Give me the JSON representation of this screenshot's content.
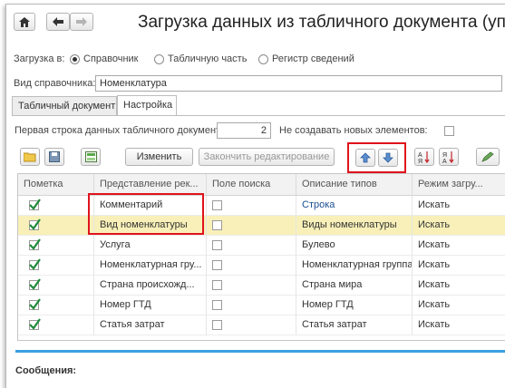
{
  "window": {
    "title": "Загрузка данных из табличного документа (управляе",
    "home_icon": "home-icon",
    "back_icon": "arrow-left-icon",
    "forward_icon": "arrow-right-icon"
  },
  "load_to": {
    "label": "Загрузка в:",
    "options": [
      {
        "label": "Справочник",
        "selected": true
      },
      {
        "label": "Табличную часть",
        "selected": false
      },
      {
        "label": "Регистр сведений",
        "selected": false
      }
    ]
  },
  "catalog_type": {
    "label": "Вид справочника:",
    "value": "Номенклатура"
  },
  "tabs": [
    {
      "label": "Табличный документ",
      "active": false
    },
    {
      "label": "Настройка",
      "active": true
    }
  ],
  "first_row": {
    "label": "Первая строка данных табличного документа:",
    "value": "2"
  },
  "no_new_elements": {
    "label": "Не создавать новых элементов:",
    "checked": false
  },
  "toolbar": {
    "edit_label": "Изменить",
    "finish_edit_label": "Закончить редактирование",
    "icons": [
      "open-folder-icon",
      "save-icon",
      "table-edit-icon",
      "move-up-icon",
      "move-down-icon",
      "sort-asc-icon",
      "sort-desc-icon"
    ]
  },
  "table": {
    "columns": [
      "Пометка",
      "Представление рек...",
      "Поле поиска",
      "Описание типов",
      "Режим загру..."
    ],
    "rows": [
      {
        "mark": true,
        "name": "Комментарий",
        "search": false,
        "types": "Строка",
        "mode": "Искать",
        "types_link": true
      },
      {
        "mark": true,
        "name": "Вид номенклатуры",
        "search": false,
        "types": "Виды номенклатуры",
        "mode": "Искать",
        "selected": true
      },
      {
        "mark": true,
        "name": "Услуга",
        "search": false,
        "types": "Булево",
        "mode": "Искать"
      },
      {
        "mark": true,
        "name": "Номенклатурная гру...",
        "search": false,
        "types": "Номенклатурная группа",
        "mode": "Искать"
      },
      {
        "mark": true,
        "name": "Страна происхожд...",
        "search": false,
        "types": "Страна мира",
        "mode": "Искать"
      },
      {
        "mark": true,
        "name": "Номер ГТД",
        "search": false,
        "types": "Номер ГТД",
        "mode": "Искать"
      },
      {
        "mark": true,
        "name": "Статья затрат",
        "search": false,
        "types": "Статья затрат",
        "mode": "Искать"
      }
    ]
  },
  "messages": {
    "label": "Сообщения:"
  },
  "colors": {
    "highlight": "#e0131d",
    "selected_row": "#f8f0b8",
    "accent_line": "#3aa0e0",
    "link": "#1b4f93"
  }
}
